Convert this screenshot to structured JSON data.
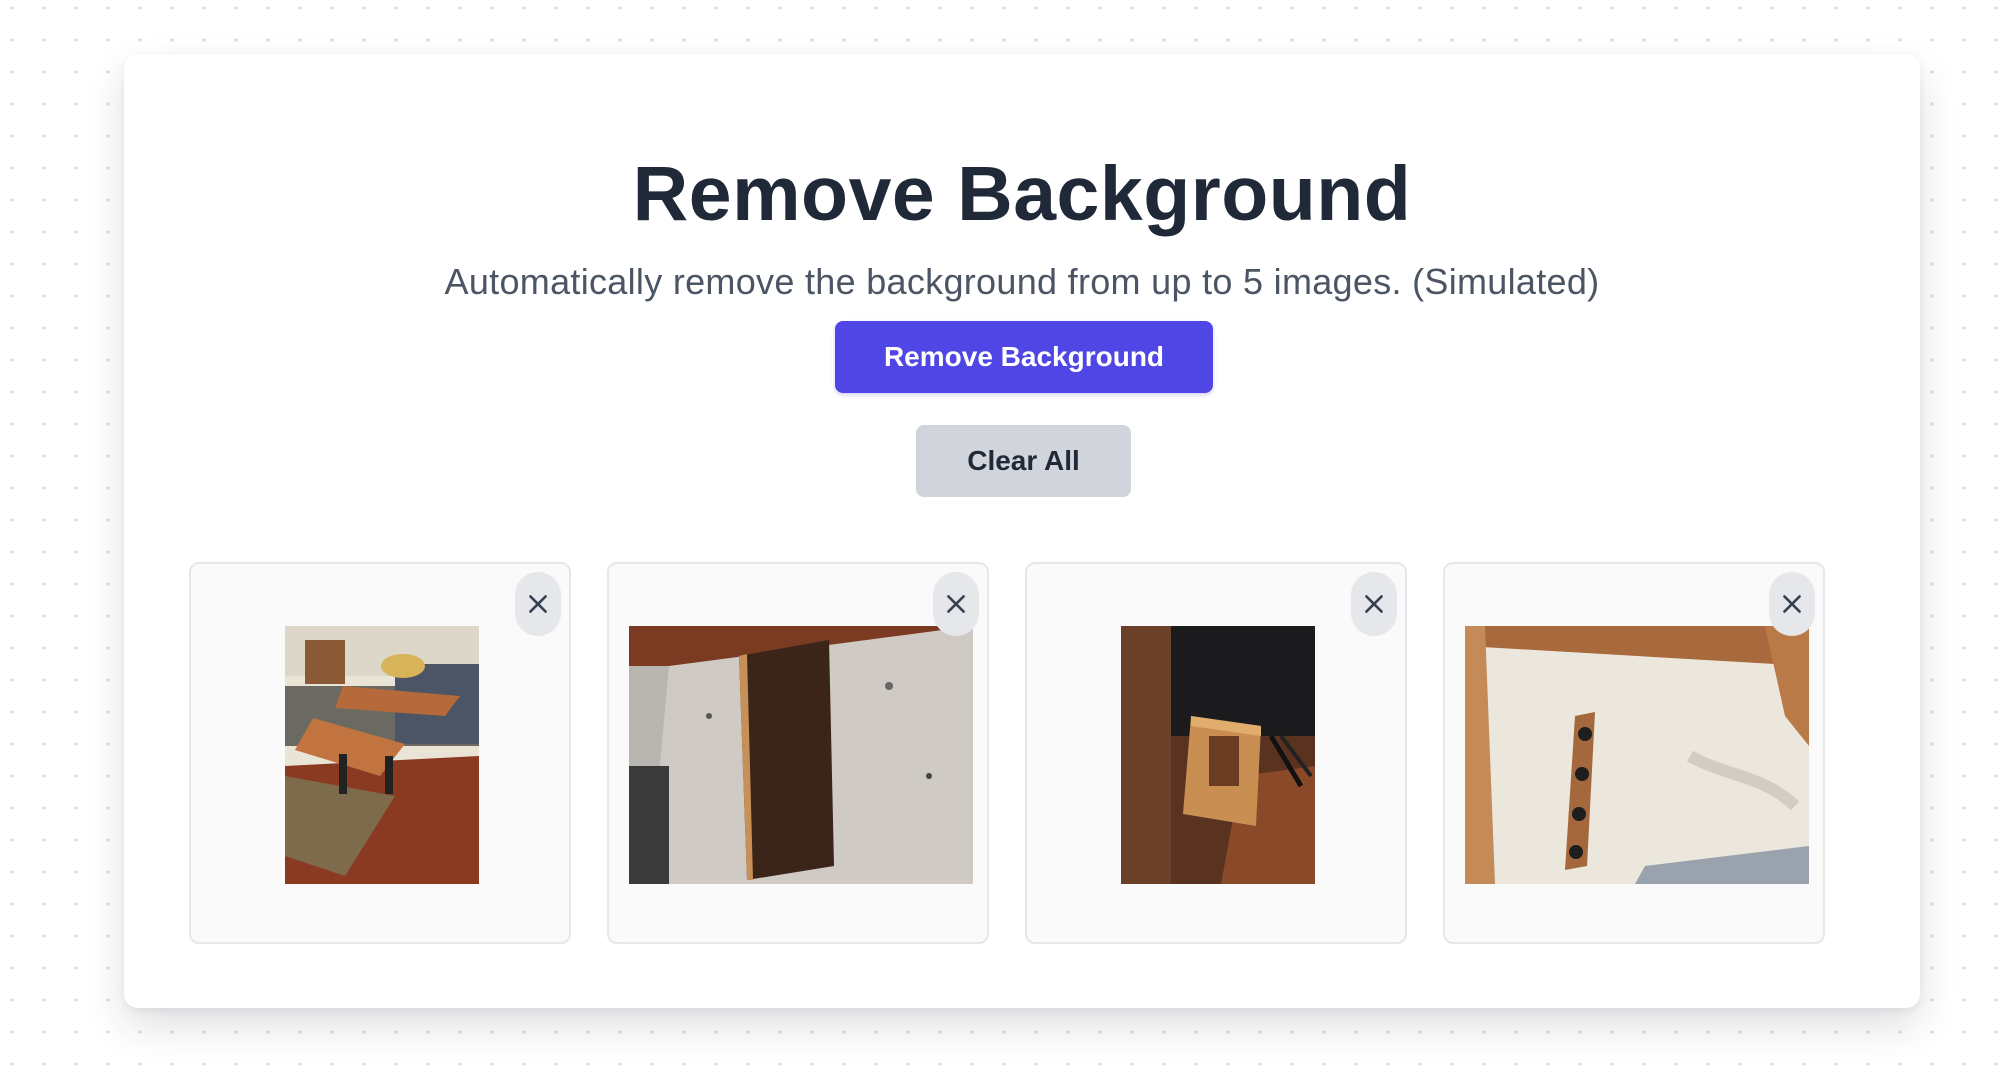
{
  "header": {
    "title": "Remove Background",
    "subtitle": "Automatically remove the background from up to 5 images. (Simulated)"
  },
  "actions": {
    "remove_label": "Remove Background",
    "clear_label": "Clear All"
  },
  "images": [
    {
      "subject": "lift-top coffee table in living room",
      "remove_icon": "close-icon"
    },
    {
      "subject": "dark wood cutting board on granite counter",
      "remove_icon": "close-icon"
    },
    {
      "subject": "wooden organizer box beside desk",
      "remove_icon": "close-icon"
    },
    {
      "subject": "wooden coat hook rack with black hooks",
      "remove_icon": "close-icon"
    }
  ],
  "colors": {
    "primary": "#4f46e5",
    "secondary": "#d1d5db",
    "title": "#1f2937",
    "subtitle": "#4b5563"
  }
}
